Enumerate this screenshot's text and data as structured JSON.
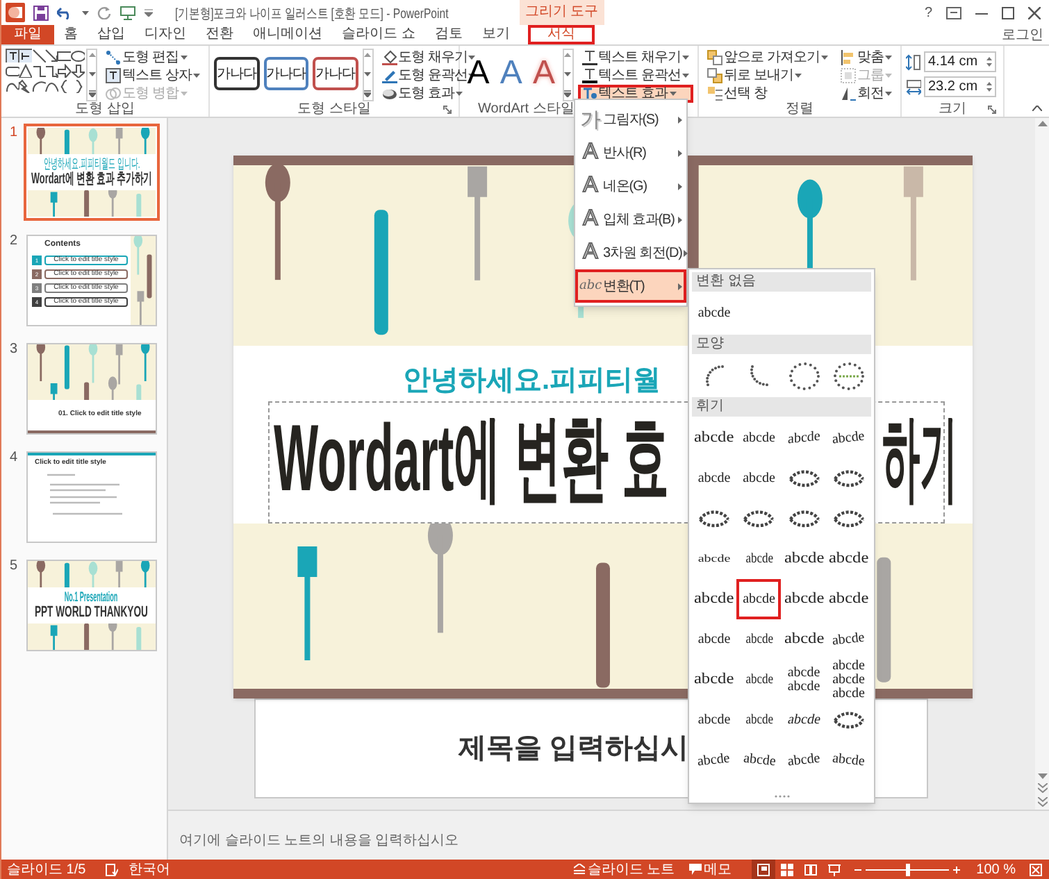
{
  "window": {
    "title": "[기본형]포크와 나이프 일러스트 [호환 모드] - PowerPoint",
    "context_label": "그리기 도구",
    "help": "?",
    "account": "로그인"
  },
  "tabs": [
    {
      "label": "파일",
      "kind": "file",
      "selected": false
    },
    {
      "label": "홈",
      "kind": "tab",
      "selected": false
    },
    {
      "label": "삽입",
      "kind": "tab",
      "selected": false
    },
    {
      "label": "디자인",
      "kind": "tab",
      "selected": false
    },
    {
      "label": "전환",
      "kind": "tab",
      "selected": false
    },
    {
      "label": "애니메이션",
      "kind": "tab",
      "selected": false
    },
    {
      "label": "슬라이드 쇼",
      "kind": "tab",
      "selected": false
    },
    {
      "label": "검토",
      "kind": "tab",
      "selected": false
    },
    {
      "label": "보기",
      "kind": "tab",
      "selected": false
    },
    {
      "label": "서식",
      "kind": "context",
      "selected": true
    }
  ],
  "ribbon": {
    "groups": [
      {
        "kind": "shapes",
        "label": "도형 삽입",
        "commands": [
          {
            "label": "도형 편집",
            "disabled": false
          },
          {
            "label": "텍스트 상자",
            "disabled": false
          },
          {
            "label": "도형 병합",
            "disabled": true
          }
        ]
      },
      {
        "kind": "shape_styles",
        "label": "도형 스타일",
        "styles": [
          {
            "label": "가나다",
            "color": "#333333"
          },
          {
            "label": "가나다",
            "color": "#4f81bd"
          },
          {
            "label": "가나다",
            "color": "#c0504d"
          }
        ],
        "commands": [
          {
            "label": "도형 채우기"
          },
          {
            "label": "도형 윤곽선"
          },
          {
            "label": "도형 효과"
          }
        ]
      },
      {
        "kind": "wordart",
        "label": "WordArt 스타일",
        "styles": [
          {
            "label": "A",
            "kind": "fill",
            "color": "#000000"
          },
          {
            "label": "A",
            "kind": "fill",
            "color": "#4f81bd"
          },
          {
            "label": "A",
            "kind": "outline",
            "color": "#c0504d"
          }
        ],
        "commands": [
          {
            "label": "텍스트 채우기",
            "selected": false
          },
          {
            "label": "텍스트 윤곽선",
            "selected": false
          },
          {
            "label": "텍스트 효과",
            "selected": true
          }
        ]
      },
      {
        "kind": "arrange",
        "label": "정렬",
        "commands": [
          {
            "label": "앞으로 가져오기",
            "disabled": false,
            "dropdown": true
          },
          {
            "label": "뒤로 보내기",
            "disabled": false,
            "dropdown": true
          },
          {
            "label": "선택 창",
            "disabled": false,
            "dropdown": false
          },
          {
            "label": "맞춤",
            "disabled": false,
            "dropdown": true
          },
          {
            "label": "그룹",
            "disabled": true,
            "dropdown": true
          },
          {
            "label": "회전",
            "disabled": false,
            "dropdown": true
          }
        ]
      },
      {
        "kind": "size",
        "label": "크기",
        "fields": [
          {
            "value": "4.14 cm"
          },
          {
            "value": "23.2 cm"
          }
        ]
      }
    ]
  },
  "thumbnails": [
    {
      "number": "1",
      "kind": "title",
      "selected": true,
      "texts": [
        "안녕하세요.피피티월드 입니다.",
        "Wordart에 변환 효과 추가하기"
      ]
    },
    {
      "number": "2",
      "kind": "contents",
      "selected": false,
      "title": "Contents",
      "items": [
        {
          "number": "1",
          "label": "Click to edit title style",
          "color": "#1aa6b7"
        },
        {
          "number": "2",
          "label": "Click to edit title style",
          "color": "#8a6a62"
        },
        {
          "number": "3",
          "label": "Click to edit title style",
          "color": "#7f7f7f"
        },
        {
          "number": "4",
          "label": "Click to edit title style",
          "color": "#404040"
        }
      ]
    },
    {
      "number": "3",
      "kind": "section",
      "selected": false,
      "title": "01. Click to edit title style"
    },
    {
      "number": "4",
      "kind": "text",
      "selected": false,
      "title": "Click to edit title style"
    },
    {
      "number": "5",
      "kind": "closing",
      "selected": false,
      "texts": [
        "No.1 Presentation",
        "PPT WORLD THANKYOU"
      ]
    }
  ],
  "slide": {
    "subtitle": "안녕하세요.피피티월",
    "title_left": "Wordart에 변환 효",
    "title_right": "하기",
    "next_placeholder": "제목을 입력하십시"
  },
  "text_effects_menu": [
    {
      "glyph": "가",
      "label": "그림자(S)",
      "kind": "shadow",
      "selected": false
    },
    {
      "glyph": "A",
      "label": "반사(R)",
      "kind": "outline",
      "selected": false
    },
    {
      "glyph": "A",
      "label": "네온(G)",
      "kind": "outline",
      "selected": false
    },
    {
      "glyph": "A",
      "label": "입체 효과(B)",
      "kind": "outline",
      "selected": false
    },
    {
      "glyph": "A",
      "label": "3차원 회전(D)",
      "kind": "outline",
      "selected": false
    },
    {
      "glyph": "abc",
      "label": "변환(T)",
      "kind": "italic",
      "selected": true
    }
  ],
  "warp_menu": {
    "sections": [
      {
        "heading": "변환 없음",
        "items": [
          {
            "kind": "plain",
            "label": "abcde",
            "selected": false
          }
        ]
      },
      {
        "heading": "모양",
        "items": [
          {
            "kind": "arc_up",
            "selected": false
          },
          {
            "kind": "arc_down",
            "selected": false
          },
          {
            "kind": "circle",
            "selected": false
          },
          {
            "kind": "button",
            "selected": false
          }
        ]
      },
      {
        "heading": "휘기",
        "items": [
          {
            "kind": "wide",
            "label": "abcde",
            "selected": false
          },
          {
            "kind": "plain",
            "label": "abcde",
            "selected": false
          },
          {
            "kind": "rise",
            "label": "abcde",
            "selected": false
          },
          {
            "kind": "up",
            "label": "abcde",
            "selected": false
          },
          {
            "kind": "plain",
            "label": "abcde",
            "selected": false
          },
          {
            "kind": "plain",
            "label": "abcde",
            "selected": false
          },
          {
            "kind": "icon",
            "selected": false
          },
          {
            "kind": "icon",
            "selected": false
          },
          {
            "kind": "icon",
            "selected": false
          },
          {
            "kind": "icon",
            "selected": false
          },
          {
            "kind": "icon",
            "selected": false
          },
          {
            "kind": "icon",
            "selected": false
          },
          {
            "kind": "short",
            "label": "abcde",
            "selected": false
          },
          {
            "kind": "narrow",
            "label": "abcde",
            "selected": false
          },
          {
            "kind": "wide",
            "label": "abcde",
            "selected": false
          },
          {
            "kind": "wide",
            "label": "abcde",
            "selected": false
          },
          {
            "kind": "wide",
            "label": "abcde",
            "selected": false
          },
          {
            "kind": "plain",
            "label": "abcde",
            "selected": true
          },
          {
            "kind": "wide",
            "label": "abcde",
            "selected": false
          },
          {
            "kind": "wide",
            "label": "abcde",
            "selected": false
          },
          {
            "kind": "plain",
            "label": "abcde",
            "selected": false
          },
          {
            "kind": "narrow",
            "label": "abcde",
            "selected": false
          },
          {
            "kind": "wide",
            "label": "abcde",
            "selected": false
          },
          {
            "kind": "up",
            "label": "abcde",
            "selected": false
          },
          {
            "kind": "wide",
            "label": "abcde",
            "selected": false
          },
          {
            "kind": "narrow",
            "label": "abcde",
            "selected": false
          },
          {
            "kind": "stack",
            "lines": [
              "abcde",
              "abcde"
            ],
            "selected": false
          },
          {
            "kind": "stack",
            "lines": [
              "abcde",
              "abcde",
              "abcde"
            ],
            "selected": false
          },
          {
            "kind": "plain",
            "label": "abcde",
            "selected": false
          },
          {
            "kind": "narrow",
            "label": "abcde",
            "selected": false
          },
          {
            "kind": "skew",
            "label": "abcde",
            "selected": false
          },
          {
            "kind": "icon",
            "selected": false
          },
          {
            "kind": "up",
            "label": "abcde",
            "selected": false
          },
          {
            "kind": "down",
            "label": "abcde",
            "selected": false
          },
          {
            "kind": "up",
            "label": "abcde",
            "selected": false
          },
          {
            "kind": "down",
            "label": "abcde",
            "selected": false
          }
        ]
      }
    ]
  },
  "notes": {
    "placeholder": "여기에 슬라이드 노트의 내용을 입력하십시오"
  },
  "status_bar": {
    "slide": "슬라이드 1/5",
    "language": "한국어",
    "notes": "슬라이드 노트",
    "comments": "메모",
    "views": [
      {
        "kind": "normal",
        "selected": true
      },
      {
        "kind": "sorter",
        "selected": false
      },
      {
        "kind": "reading",
        "selected": false
      },
      {
        "kind": "show",
        "selected": false
      }
    ],
    "zoom_slider": {
      "level": 0.5
    },
    "zoom": "100 %"
  }
}
